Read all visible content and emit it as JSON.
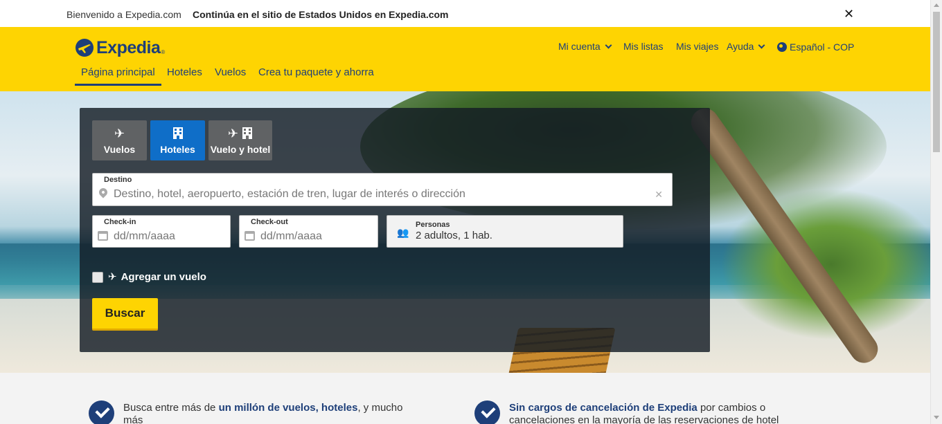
{
  "topbar": {
    "welcome": "Bienvenido a Expedia.com",
    "continue": "Continúa en el sitio de Estados Unidos en Expedia.com",
    "close": "✕"
  },
  "brand": {
    "name": "Expedia",
    "tm": "®",
    "color": "#1e3f79",
    "header_bg": "#fed402"
  },
  "account_nav": {
    "my_account": "Mi cuenta",
    "my_lists": "Mis listas",
    "my_trips": "Mis viajes",
    "help": "Ayuda",
    "language": "Español - COP"
  },
  "main_nav": {
    "home": "Página principal",
    "hotels": "Hoteles",
    "flights": "Vuelos",
    "package": "Crea tu paquete y ahorra"
  },
  "search": {
    "tabs": {
      "flights": "Vuelos",
      "hotels": "Hoteles",
      "flight_hotel": "Vuelo y hotel"
    },
    "destination": {
      "label": "Destino",
      "placeholder": "Destino, hotel, aeropuerto, estación de tren, lugar de interés o dirección"
    },
    "checkin": {
      "label": "Check-in",
      "placeholder": "dd/mm/aaaa"
    },
    "checkout": {
      "label": "Check-out",
      "placeholder": "dd/mm/aaaa"
    },
    "persons": {
      "label": "Personas",
      "value": "2 adultos, 1 hab."
    },
    "add_flight": "Agregar un vuelo",
    "search_button": "Buscar"
  },
  "benefits": {
    "b1_pre": "Busca entre más de ",
    "b1_bold": "un millón de vuelos, hoteles",
    "b1_post": ", y mucho más",
    "b2_bold": "Sin cargos de cancelación de Expedia",
    "b2_post": " por cambios o cancelaciones en la mayoría de las reservaciones de hotel"
  }
}
